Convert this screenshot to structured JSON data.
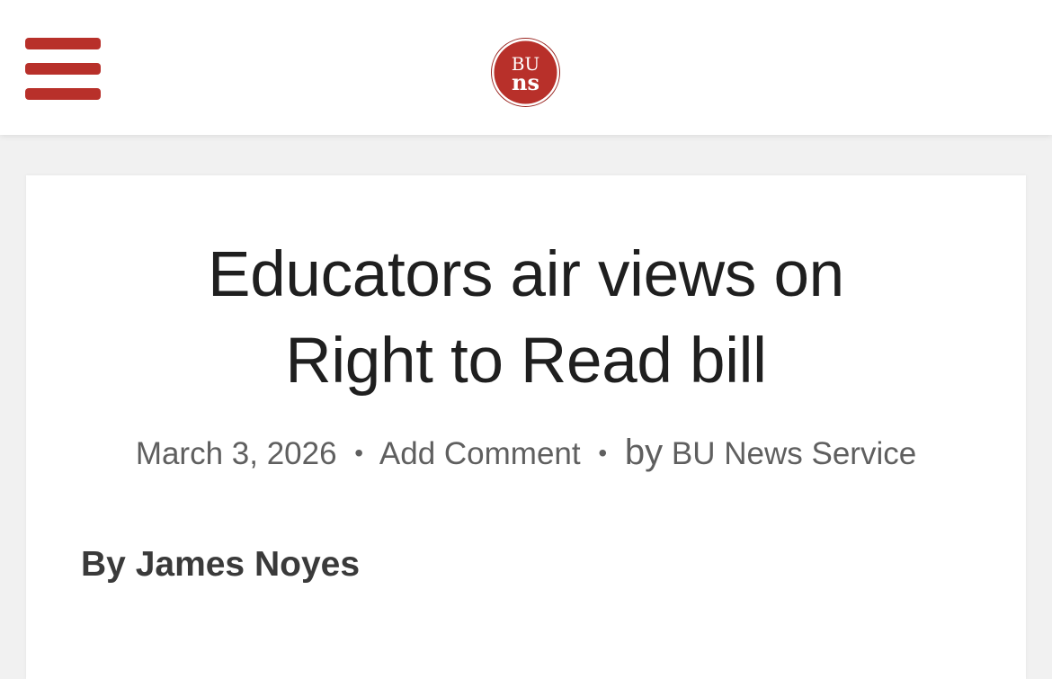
{
  "header": {
    "menu_icon": "hamburger-menu-icon",
    "logo": {
      "top_text": "BU",
      "bottom_text": "ns",
      "color": "#b8302a"
    }
  },
  "article": {
    "title_line1": "Educators air views on",
    "title_line2": "Right to Read bill",
    "date": "March 3, 2026",
    "separator": "•",
    "comment_link": "Add Comment",
    "by_word": "by",
    "author_link": "BU News Service",
    "byline": "By James Noyes"
  },
  "colors": {
    "accent": "#b8302a",
    "title": "#1f1f1f",
    "meta": "#5f5f5f",
    "byline": "#3a3a3a"
  }
}
